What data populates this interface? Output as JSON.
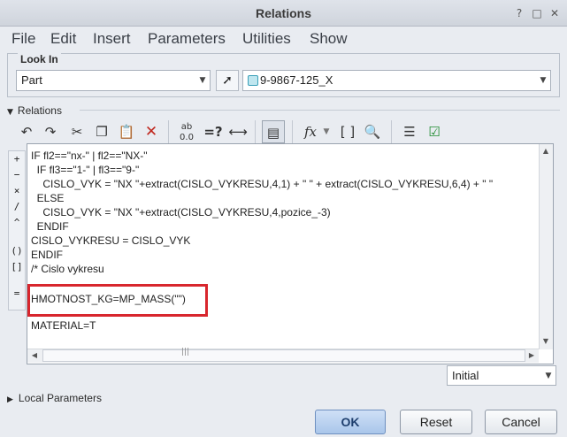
{
  "window": {
    "title": "Relations",
    "controls": {
      "help": "?",
      "minimize": "□",
      "close": "✕"
    }
  },
  "menu": [
    "File",
    "Edit",
    "Insert",
    "Parameters",
    "Utilities",
    "Show"
  ],
  "look_in": {
    "label": "Look In",
    "type_value": "Part",
    "model_value": "9-9867-125_X"
  },
  "relations": {
    "section_label": "Relations",
    "toolbar_icons": [
      "undo-icon",
      "redo-icon",
      "cut-icon",
      "copy-icon",
      "paste-icon",
      "delete-icon",
      "units-icon",
      "evaluate-icon",
      "measure-icon",
      "insert-parameter-icon",
      "function-icon",
      "brackets-icon",
      "verify-icon",
      "sort-icon",
      "check-icon"
    ],
    "operators": [
      "+",
      "−",
      "×",
      "/",
      "^",
      "()",
      "[]",
      "="
    ],
    "lines": [
      "IF fl2==\"nx-\" | fl2==\"NX-\"",
      "  IF fl3==\"1-\" | fl3==\"9-\"",
      "    CISLO_VYK = \"NX \"+extract(CISLO_VYKRESU,4,1) + \" \" + extract(CISLO_VYKRESU,6,4) + \" \"",
      "  ELSE",
      "    CISLO_VYK = \"NX \"+extract(CISLO_VYKRESU,4,pozice_-3)",
      "  ENDIF",
      "CISLO_VYKRESU = CISLO_VYK",
      "ENDIF",
      "/* Cislo vykresu",
      "",
      "HMOTNOST_KG=MP_MASS(\"\")",
      "",
      "MATERIAL=T"
    ],
    "scrollbar_grip": "|||"
  },
  "initial": {
    "value": "Initial"
  },
  "local_parameters": {
    "label": "Local Parameters"
  },
  "buttons": {
    "ok": "OK",
    "reset": "Reset",
    "cancel": "Cancel"
  },
  "colors": {
    "highlight": "#d8262d",
    "background": "#e9ecf1"
  }
}
